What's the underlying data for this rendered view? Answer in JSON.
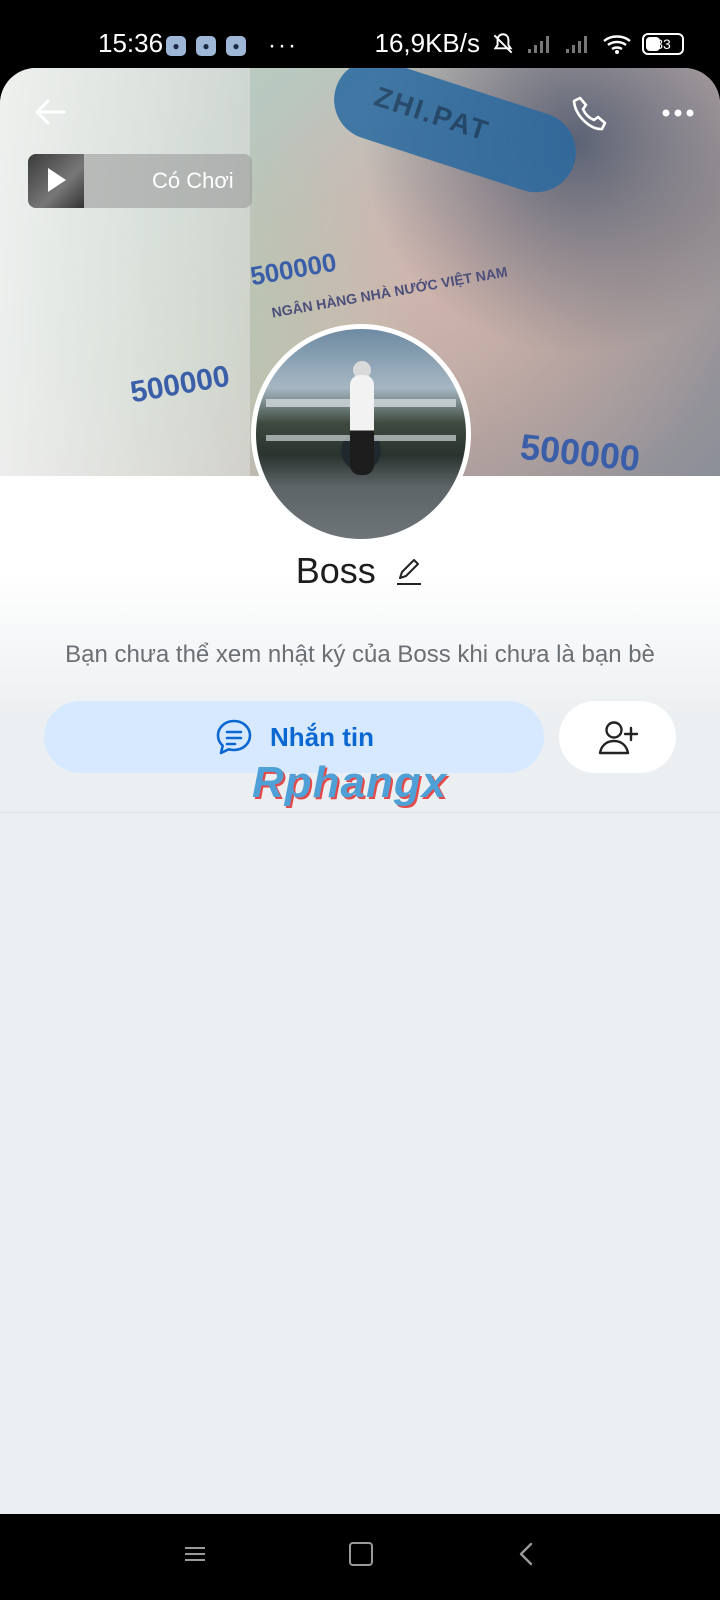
{
  "status_bar": {
    "time": "15:36",
    "more": "···",
    "network_speed": "16,9KB/s",
    "battery": "33"
  },
  "header": {
    "music": {
      "title": "Có Chơi"
    }
  },
  "cover": {
    "strap_text": "ZHI.PAT",
    "banknote_value_1": "500000",
    "banknote_value_2": "500000",
    "banknote_value_3": "500000",
    "banknote_bank": "NGÂN HÀNG NHÀ NƯỚC VIỆT NAM"
  },
  "profile": {
    "name": "Boss",
    "privacy_note": "Bạn chưa thể xem nhật ký của Boss khi chưa là bạn bè"
  },
  "actions": {
    "message_label": "Nhắn tin"
  },
  "watermark": "Rphangx",
  "colors": {
    "accent": "#0b68d1",
    "message_button_bg": "#d6e9ff",
    "page_bg": "#eceff1"
  },
  "icons": [
    "back-arrow-icon",
    "phone-icon",
    "more-icon",
    "play-icon",
    "edit-icon",
    "chat-icon",
    "add-user-icon",
    "menu-icon",
    "home-icon",
    "nav-back-icon"
  ]
}
